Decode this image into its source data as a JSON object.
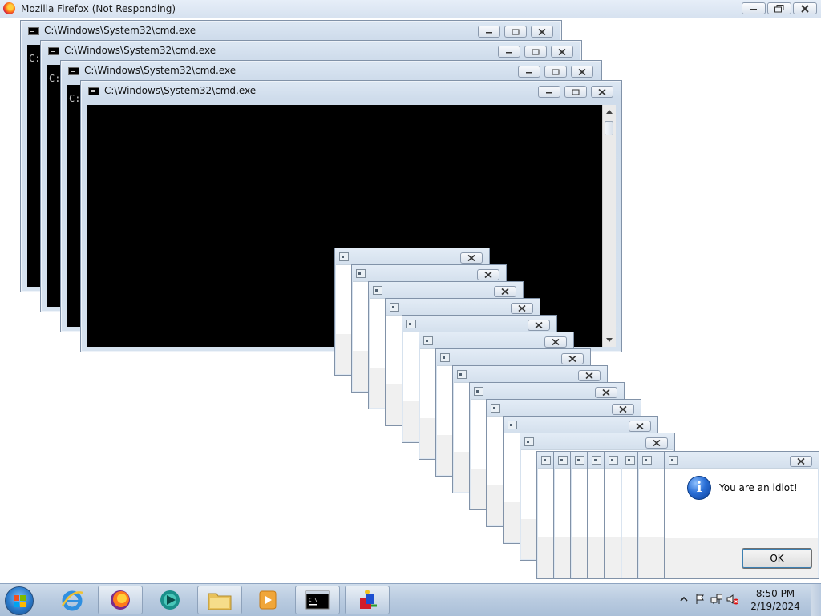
{
  "firefox": {
    "title": "Mozilla Firefox (Not Responding)"
  },
  "cmd_windows": [
    {
      "title": "C:\\Windows\\System32\\cmd.exe",
      "prompt": "C:"
    },
    {
      "title": "C:\\Windows\\System32\\cmd.exe",
      "prompt": "C:"
    },
    {
      "title": "C:\\Windows\\System32\\cmd.exe",
      "prompt": "C:"
    },
    {
      "title": "C:\\Windows\\System32\\cmd.exe",
      "prompt": ""
    }
  ],
  "message_box": {
    "text": "You are an idiot!",
    "ok_label": "OK",
    "stacked_count": 19
  },
  "taskbar": {
    "pinned": [
      "start-orb",
      "internet-explorer",
      "firefox",
      "media-app",
      "file-explorer",
      "media-player",
      "command-prompt",
      "paint-app"
    ],
    "clock_time": "8:50 PM",
    "clock_date": "2/19/2024"
  }
}
